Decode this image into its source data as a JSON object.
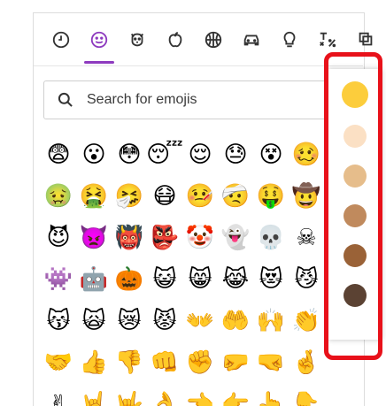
{
  "tabs": [
    {
      "name": "recent",
      "icon": "clock-icon",
      "active": false
    },
    {
      "name": "smileys",
      "icon": "smiley-icon",
      "active": true
    },
    {
      "name": "animals",
      "icon": "dog-icon",
      "active": false
    },
    {
      "name": "food",
      "icon": "apple-icon",
      "active": false
    },
    {
      "name": "activities",
      "icon": "basketball-icon",
      "active": false
    },
    {
      "name": "travel",
      "icon": "car-icon",
      "active": false
    },
    {
      "name": "objects",
      "icon": "lightbulb-icon",
      "active": false
    },
    {
      "name": "symbols",
      "icon": "symbols-icon",
      "active": false
    },
    {
      "name": "flags",
      "icon": "flag-icon",
      "active": false
    }
  ],
  "search": {
    "placeholder": "Search for emojis",
    "icon": "search-icon"
  },
  "emoji_rows": [
    [
      "😨",
      "😮",
      "😳",
      "😴",
      "😌",
      "😓",
      "😵",
      "🥴"
    ],
    [
      "🤢",
      "🤮",
      "🤧",
      "😷",
      "🤒",
      "🤕",
      "🤑",
      "🤠"
    ],
    [
      "😈",
      "👿",
      "👹",
      "👺",
      "🤡",
      "👻",
      "💀",
      "☠"
    ],
    [
      "👾",
      "🤖",
      "🎃",
      "😺",
      "😸",
      "😹",
      "😻",
      "😼"
    ],
    [
      "😽",
      "🙀",
      "😿",
      "😾",
      "👐",
      "🤲",
      "🙌",
      "👏"
    ],
    [
      "🤝",
      "👍",
      "👎",
      "👊",
      "✊",
      "🤛",
      "🤜",
      "🤞"
    ],
    [
      "✌",
      "🤘",
      "🤟",
      "👌",
      "👈",
      "👉",
      "👆",
      "👇"
    ]
  ],
  "skin_tones": [
    {
      "name": "default",
      "color": "#fccd3c",
      "selected": true
    },
    {
      "name": "light",
      "color": "#fbe0c4",
      "selected": false
    },
    {
      "name": "medium-light",
      "color": "#e6bd8b",
      "selected": false
    },
    {
      "name": "medium",
      "color": "#c08a5d",
      "selected": false
    },
    {
      "name": "medium-dark",
      "color": "#9a6237",
      "selected": false
    },
    {
      "name": "dark",
      "color": "#5b4233",
      "selected": false
    }
  ],
  "colors": {
    "accent": "#8e3bbf",
    "highlight": "#e8111a"
  }
}
